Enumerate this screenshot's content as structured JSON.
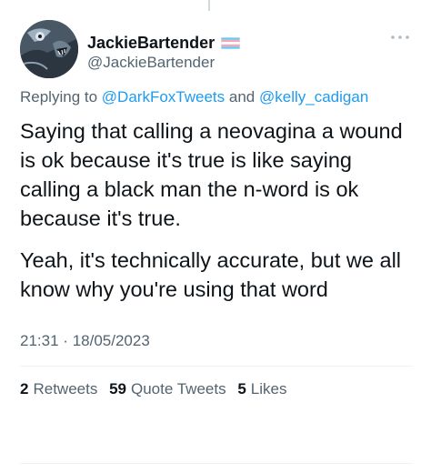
{
  "author": {
    "display_name": "JackieBartender",
    "handle": "@JackieBartender"
  },
  "reply_context": {
    "prefix": "Replying to",
    "mention_1": "@DarkFoxTweets",
    "conjunction": "and",
    "mention_2": "@kelly_cadigan"
  },
  "tweet": {
    "paragraph_1": "Saying that calling a neovagina a wound is ok because it's true is like saying calling a black man the n-word is ok because it's true.",
    "paragraph_2": "Yeah, it's technically accurate, but we all know why you're using that word",
    "time": "21:31",
    "separator": "·",
    "date": "18/05/2023"
  },
  "stats": {
    "retweets_count": "2",
    "retweets_label": "Retweets",
    "quotes_count": "59",
    "quotes_label": "Quote Tweets",
    "likes_count": "5",
    "likes_label": "Likes"
  },
  "icons": {
    "flag": "transgender-flag-icon",
    "more": "more-options-icon"
  },
  "colors": {
    "link": "#1d9bf0",
    "secondary_text": "#536471",
    "primary_text": "#0f1419",
    "flag_blue": "#5BCEFA",
    "flag_pink": "#F5A9B8",
    "flag_white": "#FFFFFF"
  }
}
